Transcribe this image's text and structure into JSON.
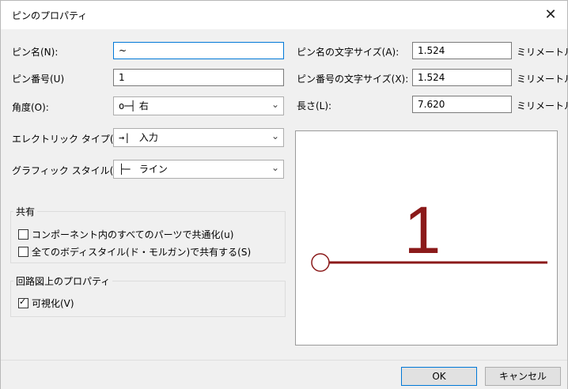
{
  "window": {
    "title": "ピンのプロパティ",
    "close_glyph": "✕"
  },
  "left": {
    "pin_name": {
      "label": "ピン名(N):",
      "value": "~"
    },
    "pin_number": {
      "label": "ピン番号(U)",
      "value": "1"
    },
    "angle": {
      "label": "角度(O):",
      "glyph": "o─┤",
      "value": "右"
    },
    "electrical_type": {
      "label": "エレクトリック タイプ(E):",
      "glyph": "→|",
      "value": "入力"
    },
    "graphic_style": {
      "label": "グラフィック スタイル(S):",
      "glyph": "├─",
      "value": "ライン"
    }
  },
  "shared_group": {
    "title": "共有",
    "option1": {
      "label": "コンポーネント内のすべてのパーツで共通化(u)",
      "checked": false
    },
    "option2": {
      "label": "全てのボディスタイル(ド・モルガン)で共有する(S)",
      "checked": false
    }
  },
  "schematic_group": {
    "title": "回路図上のプロパティ",
    "visible": {
      "label": "可視化(V)",
      "checked": true
    }
  },
  "right": {
    "name_text_size": {
      "label": "ピン名の文字サイズ(A):",
      "value": "1.524",
      "unit": "ミリメートル"
    },
    "number_text_size": {
      "label": "ピン番号の文字サイズ(X):",
      "value": "1.524",
      "unit": "ミリメートル"
    },
    "length": {
      "label": "長さ(L):",
      "value": "7.620",
      "unit": "ミリメートル"
    }
  },
  "preview": {
    "pin_number_text": "1",
    "pin_color": "#8b1a1a"
  },
  "buttons": {
    "ok": "OK",
    "cancel": "キャンセル"
  },
  "icons": {
    "dropdown": "chevron-down-icon",
    "checkmark": "checkmark-icon"
  }
}
